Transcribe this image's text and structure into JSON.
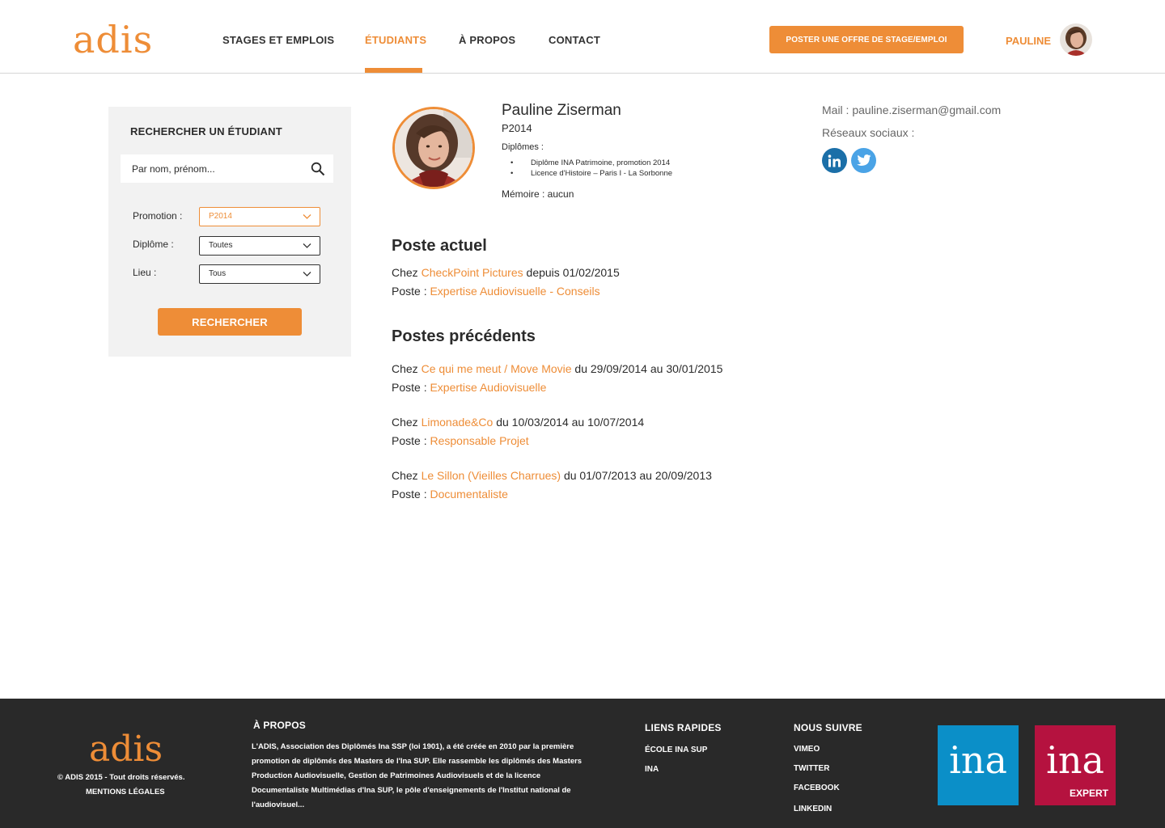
{
  "header": {
    "logo": "adis",
    "nav": [
      {
        "label": "STAGES ET EMPLOIS",
        "active": false
      },
      {
        "label": "ÉTUDIANTS",
        "active": true
      },
      {
        "label": "À PROPOS",
        "active": false
      },
      {
        "label": "CONTACT",
        "active": false
      }
    ],
    "post_button": "POSTER UNE OFFRE DE STAGE/EMPLOI",
    "user_name": "PAULINE"
  },
  "sidebar": {
    "title": "RECHERCHER UN ÉTUDIANT",
    "search_placeholder": "Par nom, prénom...",
    "filters": [
      {
        "label": "Promotion :",
        "value": "P2014"
      },
      {
        "label": "Diplôme :",
        "value": "Toutes"
      },
      {
        "label": "Lieu :",
        "value": "Tous"
      }
    ],
    "search_button": "RECHERCHER"
  },
  "profile": {
    "name": "Pauline Ziserman",
    "promotion": "P2014",
    "diplomes_label": "Diplômes :",
    "diplomes": [
      "Diplôme INA Patrimoine, promotion 2014",
      "Licence d'Histoire – Paris I - La Sorbonne"
    ],
    "memoire": "Mémoire : aucun",
    "mail": "Mail : pauline.ziserman@gmail.com",
    "social_label": "Réseaux sociaux :",
    "social": [
      "linkedin-icon",
      "twitter-icon"
    ]
  },
  "current": {
    "title": "Poste actuel",
    "chez": "Chez ",
    "company": "CheckPoint Pictures",
    "period": " depuis 01/02/2015",
    "poste_label": "Poste : ",
    "poste": "Expertise Audiovisuelle - Conseils"
  },
  "previous": {
    "title": "Postes précédents",
    "jobs": [
      {
        "chez": "Chez ",
        "company": "Ce qui me meut / Move Movie",
        "period": " du 29/09/2014 au 30/01/2015",
        "poste_label": "Poste : ",
        "poste": "Expertise Audiovisuelle"
      },
      {
        "chez": "Chez ",
        "company": "Limonade&Co",
        "period": " du 10/03/2014 au 10/07/2014",
        "poste_label": "Poste : ",
        "poste": "Responsable Projet"
      },
      {
        "chez": "Chez ",
        "company": "Le Sillon (Vieilles Charrues)",
        "period": " du 01/07/2013 au 20/09/2013",
        "poste_label": "Poste : ",
        "poste": "Documentaliste"
      }
    ]
  },
  "footer": {
    "logo": "adis",
    "copyright": "© ADIS 2015 - Tout droits réservés.",
    "legal": "MENTIONS LÉGALES",
    "about_title": "À PROPOS",
    "about_text": "L'ADIS, Association des Diplômés Ina SSP (loi 1901), a été créée en 2010 par la première promotion de diplômés des Masters de l'Ina SUP. Elle rassemble les diplômés des Masters Production Audiovisuelle, Gestion de Patrimoines Audiovisuels et de la licence Documentaliste Multimédias d'Ina SUP, le pôle d'enseignements de l'Institut national de l'audiovisuel...",
    "quick_title": "LIENS RAPIDES",
    "quick_links": [
      "ÉCOLE INA SUP",
      "INA"
    ],
    "follow_title": "NOUS SUIVRE",
    "follow_links": [
      "VIMEO",
      "TWITTER",
      "FACEBOOK",
      "LINKEDIN"
    ],
    "ina_logo": "ina",
    "ina_expert_logo": "ina",
    "ina_expert_sub": "EXPERT"
  },
  "colors": {
    "accent": "#ee8d37",
    "footer_bg": "#292929",
    "ina_blue": "#0b8fc8",
    "ina_red": "#b5123f",
    "linkedin": "#1b6fa8",
    "twitter": "#4aa3e6"
  }
}
